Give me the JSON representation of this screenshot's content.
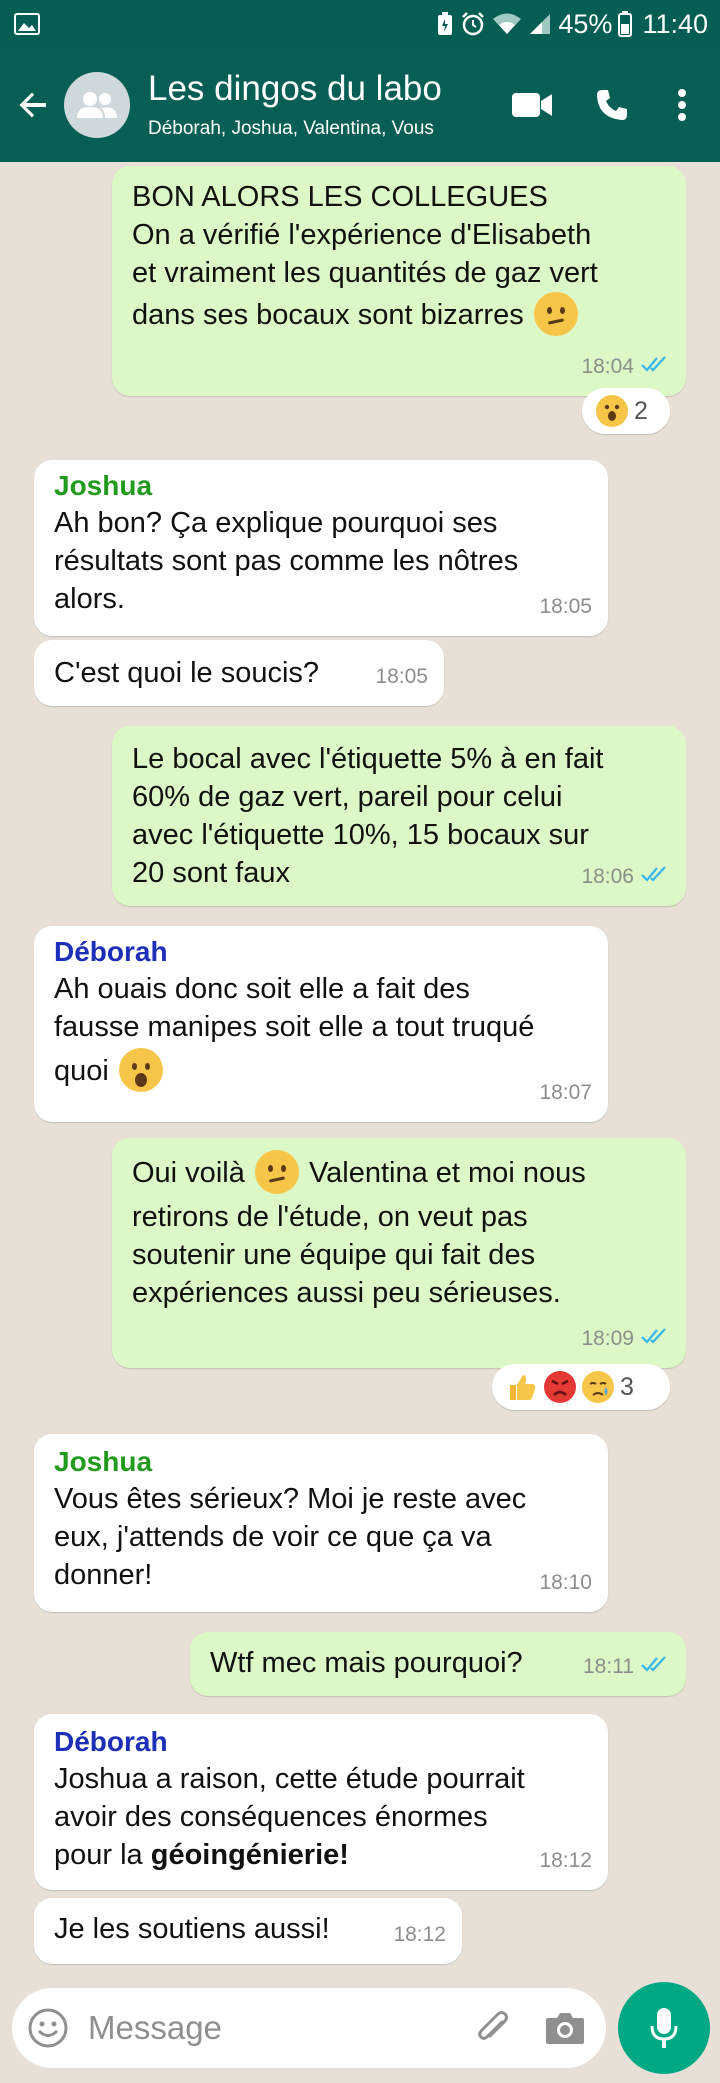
{
  "status_bar": {
    "battery": "45%",
    "time": "11:40"
  },
  "header": {
    "title": "Les dingos du labo",
    "members": "Déborah, Joshua, Valentina, Vous"
  },
  "messages": [
    {
      "type": "out",
      "lines": [
        "BON ALORS LES COLLEGUES",
        "On a vérifié l'expérience d'Elisabeth",
        "et vraiment les quantités de gaz vert",
        "dans ses bocaux sont bizarres"
      ],
      "time": "18:04",
      "reaction_count": "2"
    },
    {
      "type": "in",
      "sender": "Joshua",
      "lines": [
        "Ah bon? Ça explique pourquoi ses",
        "résultats sont pas comme les nôtres",
        "alors."
      ],
      "time": "18:05"
    },
    {
      "type": "in",
      "lines": [
        "C'est quoi le soucis?"
      ],
      "time": "18:05"
    },
    {
      "type": "out",
      "lines": [
        "Le bocal avec l'étiquette 5% à en fait",
        "60% de gaz vert, pareil pour celui",
        "avec l'étiquette 10%, 15 bocaux sur",
        "20 sont faux"
      ],
      "time": "18:06"
    },
    {
      "type": "in",
      "sender": "Déborah",
      "lines": [
        "Ah ouais donc soit elle a fait des",
        "fausse manipes soit elle a tout truqué",
        "quoi"
      ],
      "time": "18:07"
    },
    {
      "type": "out",
      "lines": [
        "Oui voilà",
        "Valentina et moi nous",
        "retirons de l'étude, on veut pas",
        "soutenir une équipe qui fait des",
        "expériences aussi peu sérieuses."
      ],
      "time": "18:09",
      "reaction_count": "3"
    },
    {
      "type": "in",
      "sender": "Joshua",
      "lines": [
        "Vous êtes sérieux? Moi je reste avec",
        "eux, j'attends de voir ce que ça va",
        "donner!"
      ],
      "time": "18:10"
    },
    {
      "type": "out",
      "lines": [
        "Wtf mec mais pourquoi?"
      ],
      "time": "18:11"
    },
    {
      "type": "in",
      "sender": "Déborah",
      "lines": [
        "Joshua a raison, cette étude pourrait",
        "avoir des conséquences énormes",
        "pour la",
        "géoingénierie!"
      ],
      "time": "18:12"
    },
    {
      "type": "in",
      "lines": [
        "Je les soutiens aussi!"
      ],
      "time": "18:12"
    }
  ],
  "input": {
    "placeholder": "Message"
  },
  "colors": {
    "header": "#075e54",
    "outgoing": "#dcf8c6",
    "incoming": "#ffffff",
    "accent": "#00a884",
    "tick_blue": "#34b7f1"
  },
  "icons": [
    "back-arrow-icon",
    "group-avatar-icon",
    "video-call-icon",
    "phone-icon",
    "more-vert-icon",
    "emoji-icon",
    "attach-icon",
    "camera-icon",
    "mic-icon",
    "double-check-icon"
  ]
}
